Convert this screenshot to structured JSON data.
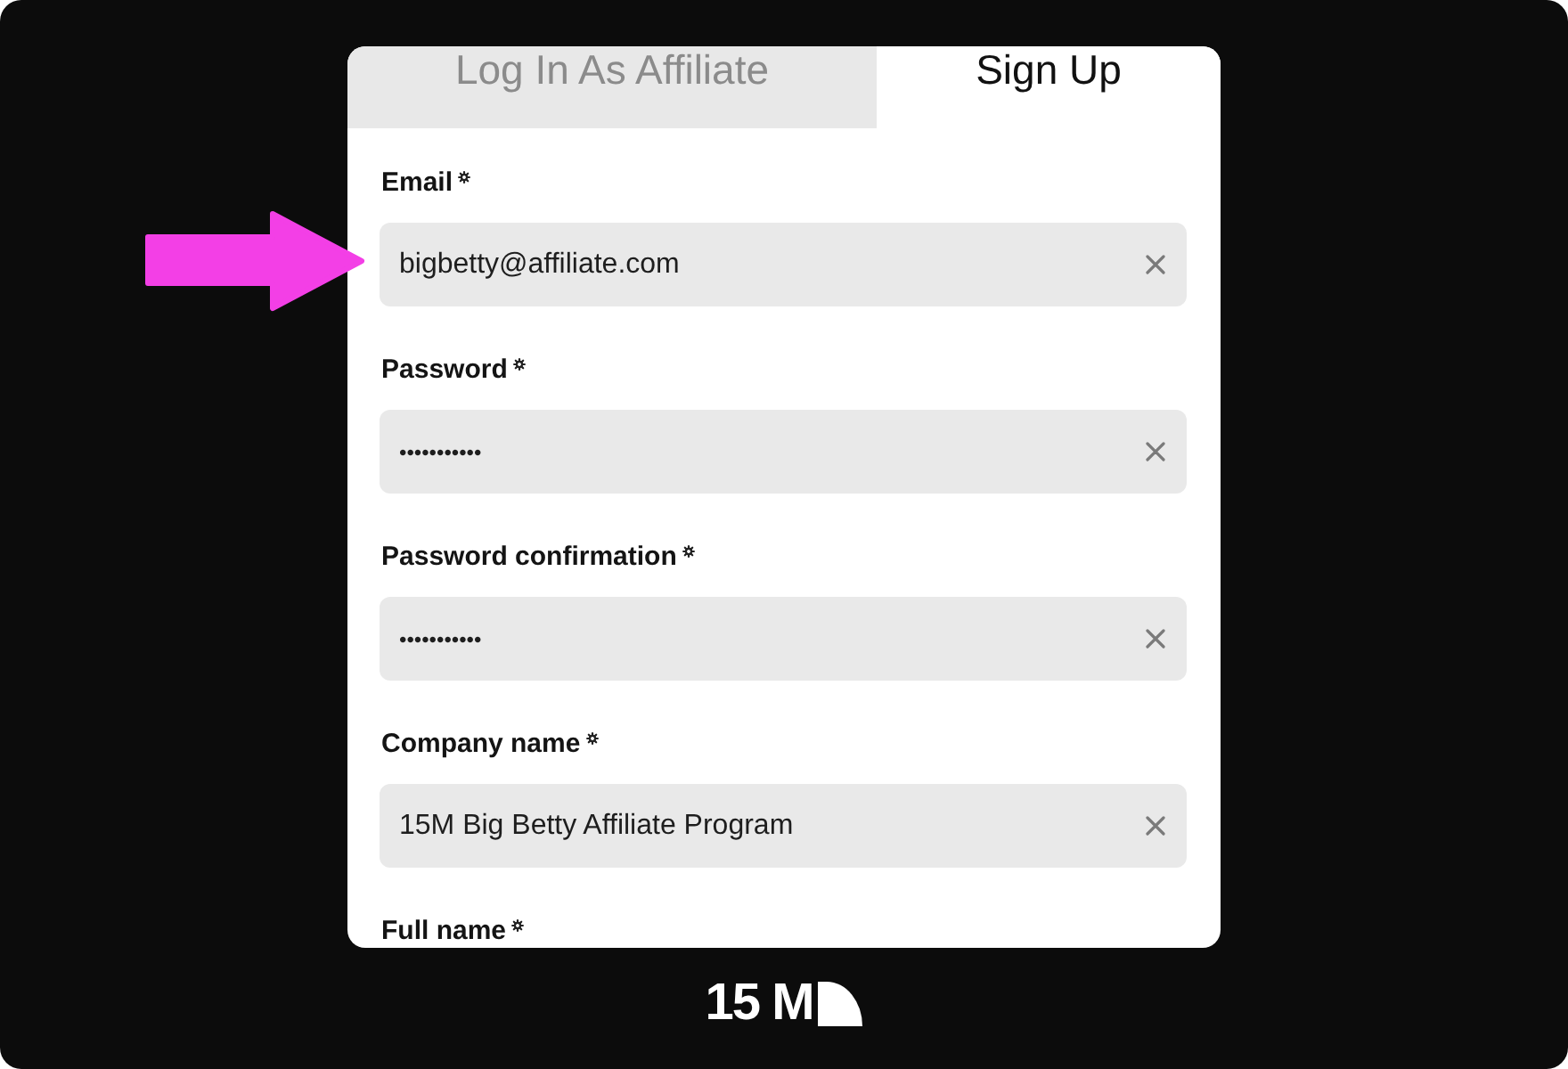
{
  "tabs": [
    {
      "label": "Log In As Affiliate",
      "selected": false
    },
    {
      "label": "Sign Up",
      "selected": true
    }
  ],
  "form": {
    "fields": [
      {
        "kind": "text",
        "label": "Email",
        "required": true,
        "value": "bigbetty@affiliate.com"
      },
      {
        "kind": "password",
        "label": "Password",
        "required": true,
        "value": "•••••••••••"
      },
      {
        "kind": "password",
        "label": "Password confirmation",
        "required": true,
        "value": "•••••••••••"
      },
      {
        "kind": "text",
        "label": "Company name",
        "required": true,
        "value": "15M Big Betty Affiliate Program"
      },
      {
        "label": "Full name",
        "required": true
      }
    ]
  },
  "logo": {
    "text": "15 M"
  }
}
